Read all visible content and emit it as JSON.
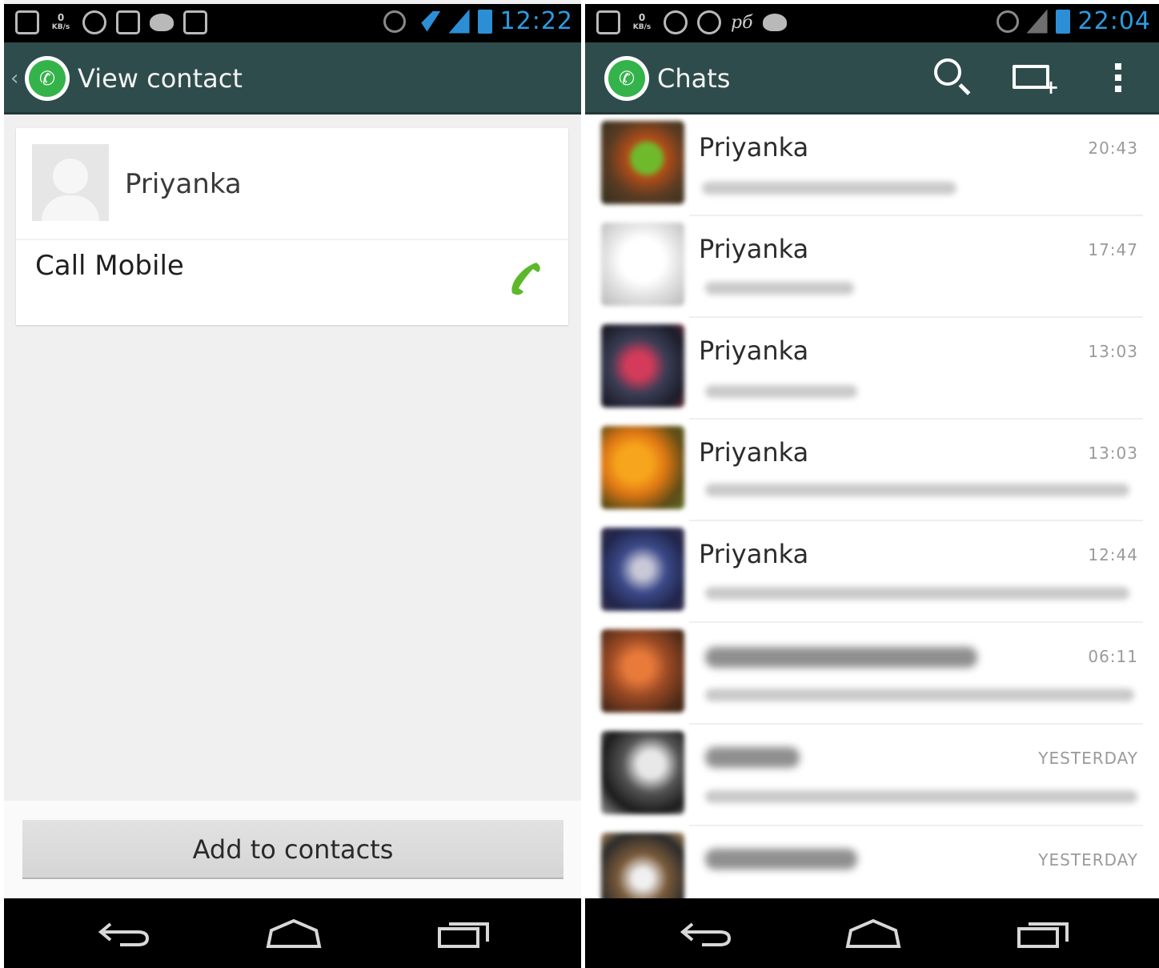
{
  "left": {
    "status": {
      "time": "12:22",
      "kb_value": "0",
      "kb_unit": "KB/s"
    },
    "actionbar": {
      "title": "View contact"
    },
    "contact": {
      "name": "Priyanka",
      "call_label": "Call Mobile"
    },
    "add_button": "Add to contacts"
  },
  "right": {
    "status": {
      "time": "22:04",
      "kb_value": "0",
      "kb_unit": "KB/s",
      "carrier_glyph": "pб"
    },
    "actionbar": {
      "title": "Chats"
    },
    "chats": [
      {
        "name": "Priyanka",
        "time": "20:43"
      },
      {
        "name": "Priyanka",
        "time": "17:47"
      },
      {
        "name": "Priyanka",
        "time": "13:03"
      },
      {
        "name": "Priyanka",
        "time": "13:03"
      },
      {
        "name": "Priyanka",
        "time": "12:44"
      },
      {
        "name": "",
        "time": "06:11"
      },
      {
        "name": "",
        "time": "YESTERDAY"
      },
      {
        "name": "",
        "time": "YESTERDAY"
      }
    ]
  },
  "colors": {
    "actionbar": "#2f4c4c",
    "whatsapp_green": "#34b34a",
    "status_blue": "#2c8fd6",
    "call_green": "#5cb82a"
  },
  "icons": {
    "left_actionbar": [
      "back-chevron-icon",
      "whatsapp-logo-icon"
    ],
    "right_actionbar": [
      "whatsapp-logo-icon",
      "search-icon",
      "new-chat-icon",
      "overflow-menu-icon"
    ],
    "navbar": [
      "back-icon",
      "home-icon",
      "recent-apps-icon"
    ]
  }
}
